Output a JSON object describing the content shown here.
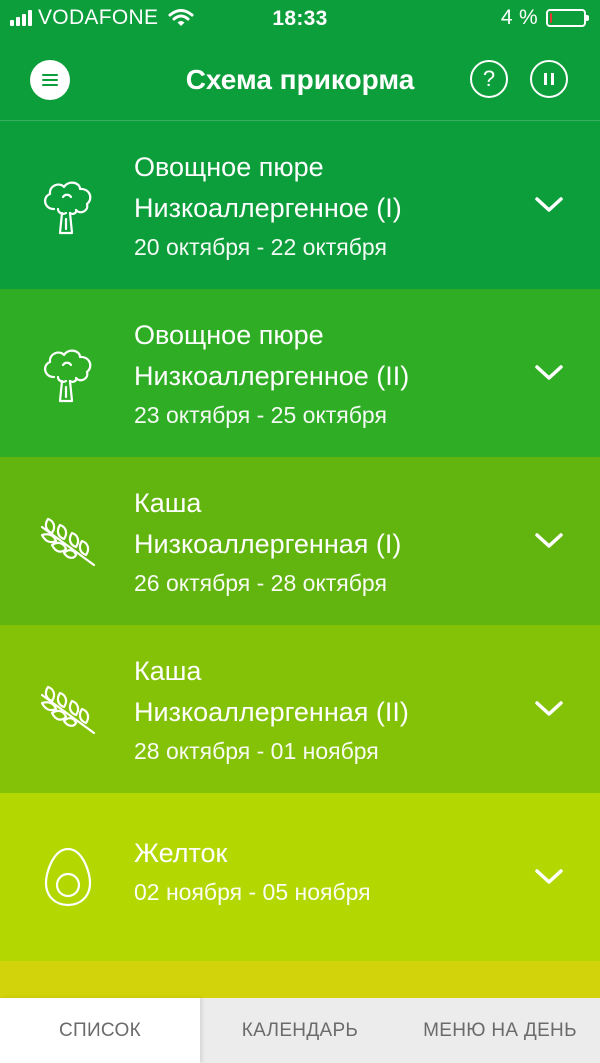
{
  "status_bar": {
    "carrier": "VODAFONE",
    "time": "18:33",
    "battery": "4 %",
    "battery_level": 0.04
  },
  "header": {
    "title": "Схема прикорма",
    "help_label": "?"
  },
  "colors": {
    "header": "#0c9e3a",
    "card1": "#0c9e3a",
    "card2": "#2fae25",
    "card3": "#62b50f",
    "card4": "#83c206",
    "card5": "#b3d700",
    "card6": "#d2d30a",
    "battery_low": "#e53935"
  },
  "items": [
    {
      "icon": "broccoli-icon",
      "title": "Овощное пюре",
      "subtitle": "Низкоаллергенное (I)",
      "dates": "20 октября - 22 октября"
    },
    {
      "icon": "broccoli-icon",
      "title": "Овощное пюре",
      "subtitle": "Низкоаллергенное (II)",
      "dates": "23 октября - 25 октября"
    },
    {
      "icon": "wheat-icon",
      "title": "Каша",
      "subtitle": "Низкоаллергенная (I)",
      "dates": "26 октября - 28 октября"
    },
    {
      "icon": "wheat-icon",
      "title": "Каша",
      "subtitle": "Низкоаллергенная (II)",
      "dates": "28 октября - 01 ноября"
    },
    {
      "icon": "egg-icon",
      "title": "Желток",
      "dates": "02 ноября - 05 ноября"
    }
  ],
  "tabs": [
    {
      "label": "СПИСОК",
      "active": true
    },
    {
      "label": "КАЛЕНДАРЬ",
      "active": false
    },
    {
      "label": "МЕНЮ НА ДЕНЬ",
      "active": false
    }
  ]
}
